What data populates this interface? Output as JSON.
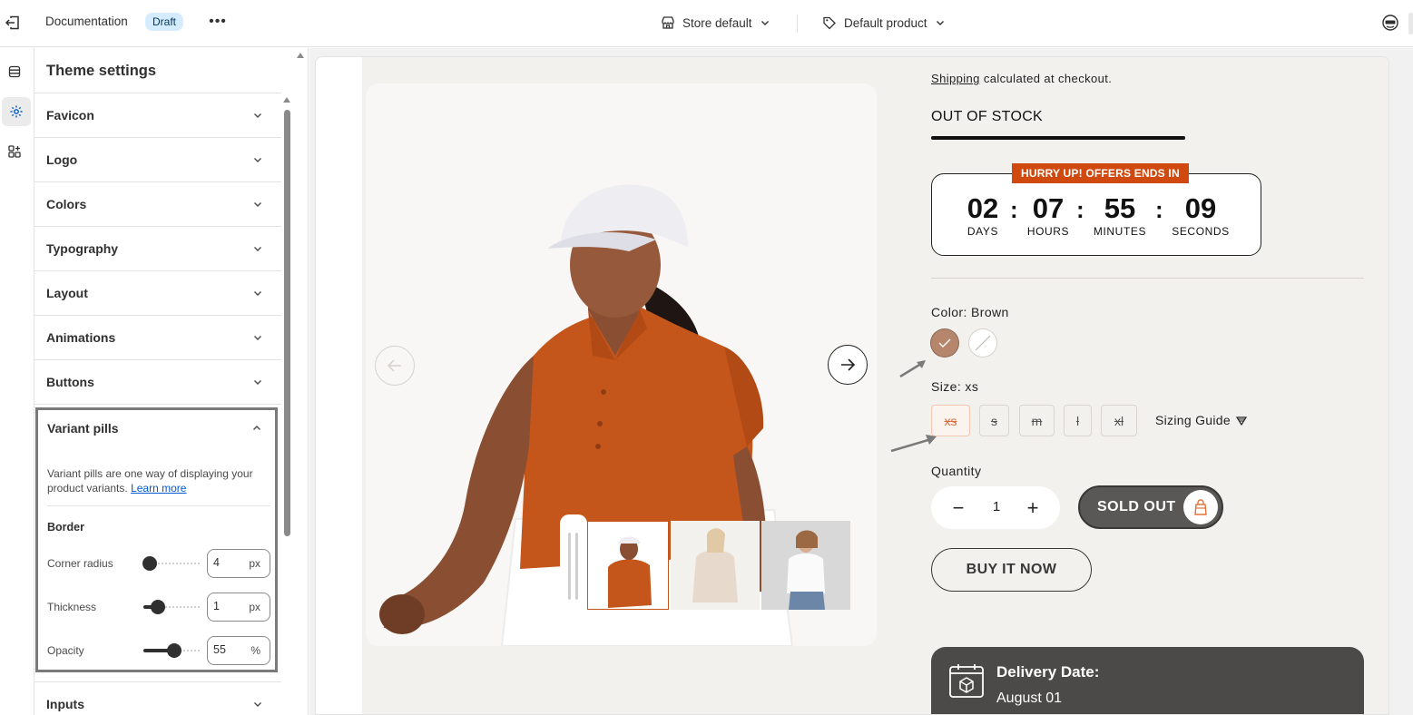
{
  "topbar": {
    "doc_title": "Documentation",
    "draft_badge": "Draft",
    "store_selector": "Store default",
    "product_selector": "Default product"
  },
  "panel": {
    "title": "Theme settings",
    "sections": [
      {
        "label": "Favicon"
      },
      {
        "label": "Logo"
      },
      {
        "label": "Colors"
      },
      {
        "label": "Typography"
      },
      {
        "label": "Layout"
      },
      {
        "label": "Animations"
      },
      {
        "label": "Buttons"
      }
    ],
    "variant_pills": {
      "label": "Variant pills",
      "description": "Variant pills are one way of displaying your product variants.",
      "learn_more": "Learn more",
      "border_heading": "Border",
      "corner_radius": {
        "label": "Corner radius",
        "value": "4",
        "unit": "px",
        "level": 0.12
      },
      "thickness": {
        "label": "Thickness",
        "value": "1",
        "unit": "px",
        "level": 0.25
      },
      "opacity": {
        "label": "Opacity",
        "value": "55",
        "unit": "%",
        "level": 0.55
      }
    },
    "after_sections": [
      {
        "label": "Inputs"
      }
    ]
  },
  "product": {
    "shipping_link": "Shipping",
    "shipping_text": " calculated at checkout.",
    "stock_status": "OUT OF STOCK",
    "countdown": {
      "badge": "HURRY UP! OFFERS ENDS IN",
      "days": "02",
      "days_label": "DAYS",
      "hours": "07",
      "hours_label": "HOURS",
      "minutes": "55",
      "minutes_label": "MINUTES",
      "seconds": "09",
      "seconds_label": "SECONDS"
    },
    "color_label": "Color: Brown",
    "colors": [
      {
        "name": "brown",
        "hex": "#b5856c",
        "selected": true
      },
      {
        "name": "white",
        "hex": "#ffffff",
        "selected": false
      }
    ],
    "size_label": "Size: xs",
    "sizes": [
      "xs",
      "s",
      "m",
      "l",
      "xl"
    ],
    "sizing_guide": "Sizing Guide",
    "quantity_label": "Quantity",
    "quantity": "1",
    "sold_out": "SOLD OUT",
    "buy_now": "BUY IT NOW",
    "delivery_title": "Delivery Date:",
    "delivery_date": "August 01"
  },
  "colors": {
    "accent_orange": "#d04a0f",
    "shirt_orange": "#c4561c",
    "store_bg": "#f3f1ee",
    "button_dark": "#5a5856"
  }
}
